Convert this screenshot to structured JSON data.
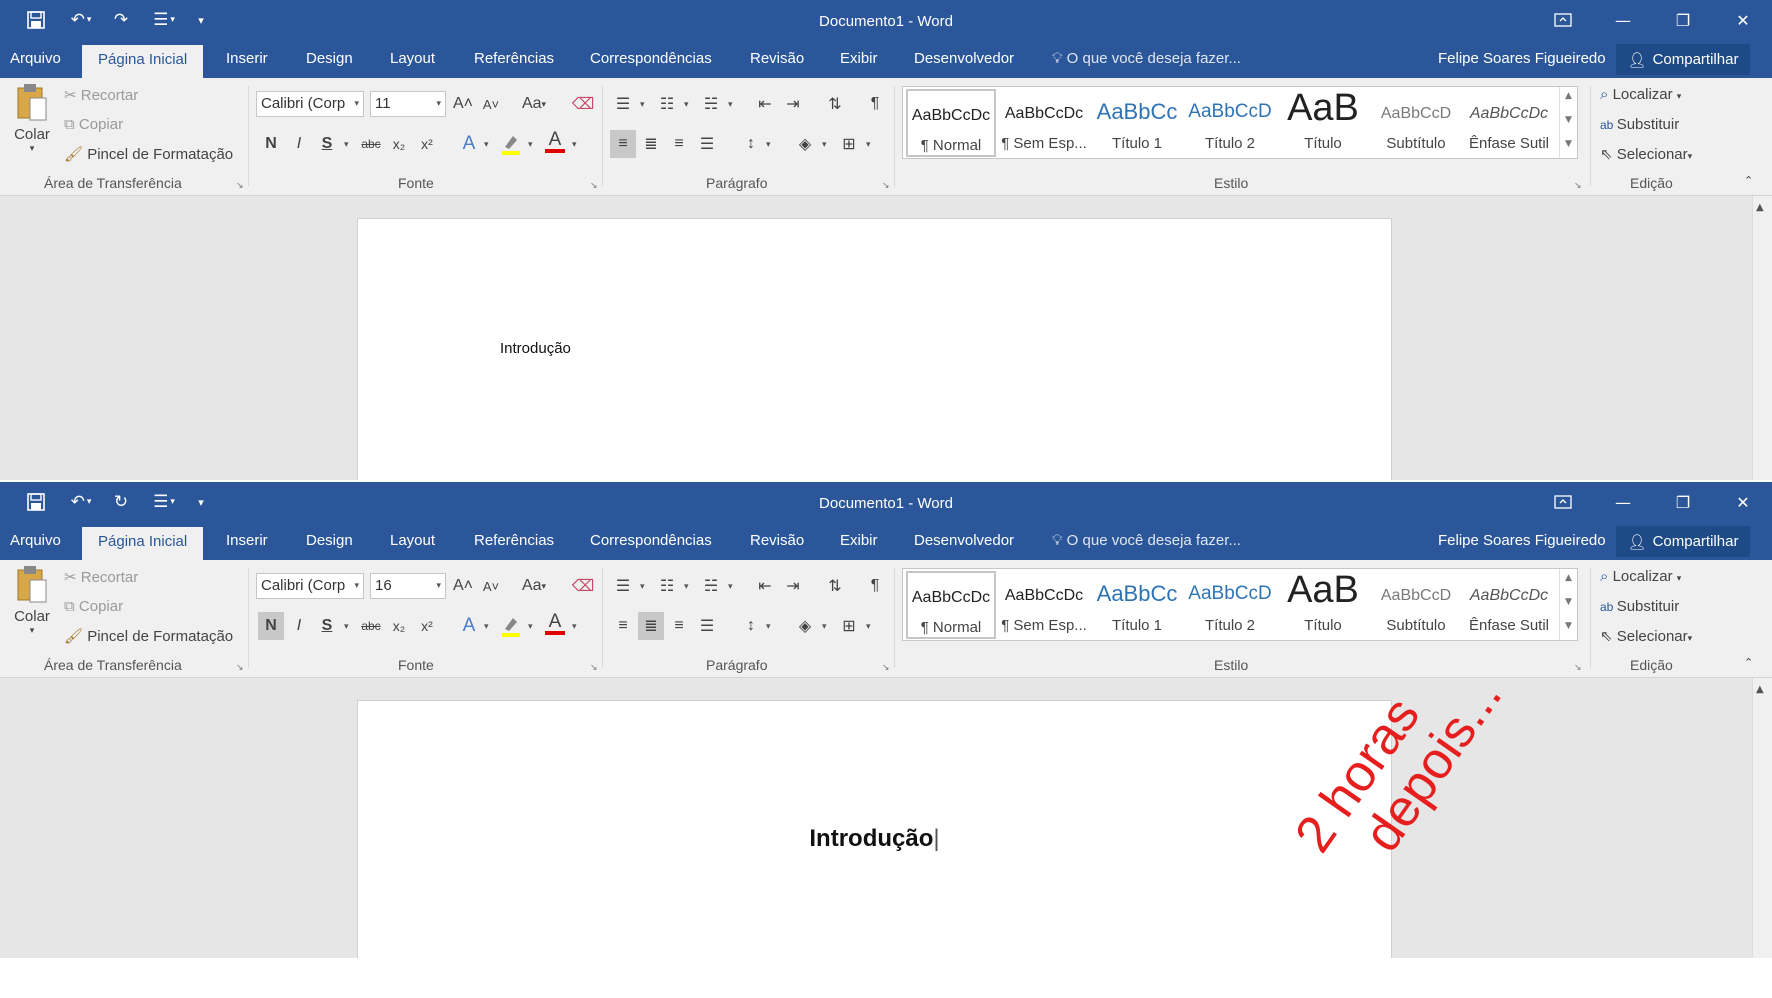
{
  "windows": [
    {
      "title": "Documento1 - Word",
      "qat": {
        "save": "🖫",
        "undo": "↶",
        "redo": "↷",
        "custom": "☰",
        "more": "▾"
      },
      "tabs": [
        "Arquivo",
        "Página Inicial",
        "Inserir",
        "Design",
        "Layout",
        "Referências",
        "Correspondências",
        "Revisão",
        "Exibir",
        "Desenvolvedor"
      ],
      "tell_me": "O que você deseja fazer...",
      "user": "Felipe Soares Figueiredo",
      "share": "Compartilhar",
      "clipboard": {
        "paste": "Colar",
        "cut": "Recortar",
        "copy": "Copiar",
        "format_painter": "Pincel de Formatação",
        "group": "Área de Transferência"
      },
      "font": {
        "name": "Calibri (Corp",
        "size": "11",
        "group": "Fonte",
        "bold": "N",
        "italic": "I",
        "underline": "S",
        "strike": "abc",
        "sub": "x₂",
        "sup": "x²",
        "grow": "A˄",
        "shrink": "A˅",
        "case": "Aa",
        "bold_active": false
      },
      "paragraph": {
        "group": "Parágrafo",
        "alignment": "left"
      },
      "styles": {
        "group": "Estilo",
        "items": [
          {
            "preview": "AaBbCcDc",
            "name": "¶ Normal"
          },
          {
            "preview": "AaBbCcDc",
            "name": "¶ Sem Esp..."
          },
          {
            "preview": "AaBbCc",
            "name": "Título 1"
          },
          {
            "preview": "AaBbCcD",
            "name": "Título 2"
          },
          {
            "preview": "AaB",
            "name": "Título"
          },
          {
            "preview": "AaBbCcD",
            "name": "Subtítulo"
          },
          {
            "preview": "AaBbCcDc",
            "name": "Ênfase Sutil"
          }
        ]
      },
      "editing": {
        "group": "Edição",
        "find": "Localizar",
        "replace": "Substituir",
        "select": "Selecionar"
      },
      "document": {
        "text": "Introdução"
      }
    },
    {
      "title": "Documento1 - Word",
      "qat": {
        "save": "🖫",
        "undo": "↶",
        "redo": "↻",
        "custom": "☰",
        "more": "▾"
      },
      "tabs": [
        "Arquivo",
        "Página Inicial",
        "Inserir",
        "Design",
        "Layout",
        "Referências",
        "Correspondências",
        "Revisão",
        "Exibir",
        "Desenvolvedor"
      ],
      "tell_me": "O que você deseja fazer...",
      "user": "Felipe Soares Figueiredo",
      "share": "Compartilhar",
      "clipboard": {
        "paste": "Colar",
        "cut": "Recortar",
        "copy": "Copiar",
        "format_painter": "Pincel de Formatação",
        "group": "Área de Transferência"
      },
      "font": {
        "name": "Calibri (Corp",
        "size": "16",
        "group": "Fonte",
        "bold": "N",
        "italic": "I",
        "underline": "S",
        "strike": "abc",
        "sub": "x₂",
        "sup": "x²",
        "grow": "A˄",
        "shrink": "A˅",
        "case": "Aa",
        "bold_active": true
      },
      "paragraph": {
        "group": "Parágrafo",
        "alignment": "center"
      },
      "styles": {
        "group": "Estilo",
        "items": [
          {
            "preview": "AaBbCcDc",
            "name": "¶ Normal"
          },
          {
            "preview": "AaBbCcDc",
            "name": "¶ Sem Esp..."
          },
          {
            "preview": "AaBbCc",
            "name": "Título 1"
          },
          {
            "preview": "AaBbCcD",
            "name": "Título 2"
          },
          {
            "preview": "AaB",
            "name": "Título"
          },
          {
            "preview": "AaBbCcD",
            "name": "Subtítulo"
          },
          {
            "preview": "AaBbCcDc",
            "name": "Ênfase Sutil"
          }
        ]
      },
      "editing": {
        "group": "Edição",
        "find": "Localizar",
        "replace": "Substituir",
        "select": "Selecionar"
      },
      "document": {
        "text": "Introdução"
      }
    }
  ],
  "overlay": {
    "line1": "2 horas",
    "line2": "depois...",
    "color": "#e61e1e"
  },
  "colors": {
    "titlebar": "#2b579a",
    "ribbon": "#f0f0f0",
    "canvas": "#e6e6e6"
  }
}
